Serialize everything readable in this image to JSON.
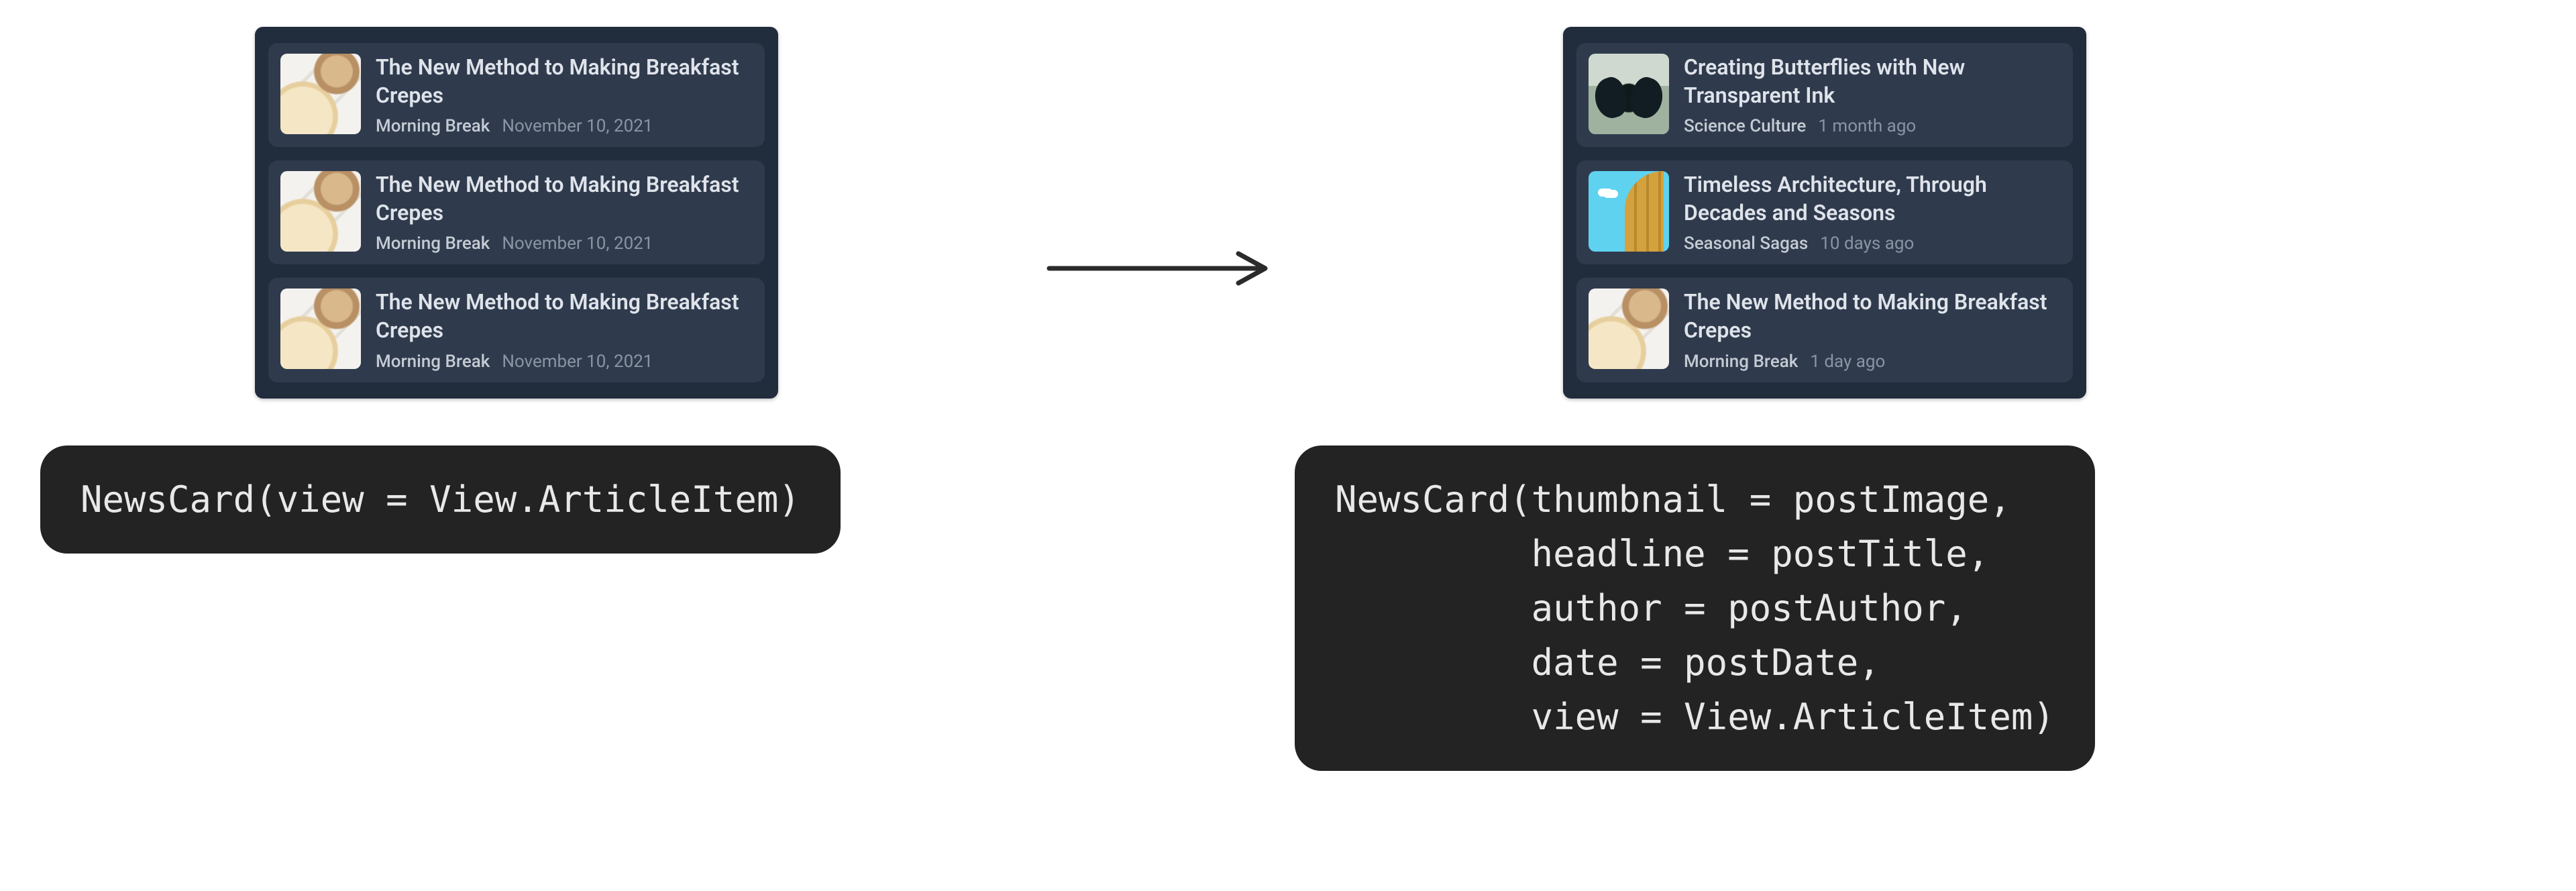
{
  "arrow": {
    "kind": "right"
  },
  "left": {
    "cards": [
      {
        "thumbClass": "thumb-crepes",
        "headline": "The New Method to Making Breakfast Crepes",
        "author": "Morning Break",
        "date": "November 10, 2021"
      },
      {
        "thumbClass": "thumb-crepes",
        "headline": "The New Method to Making Breakfast Crepes",
        "author": "Morning Break",
        "date": "November 10, 2021"
      },
      {
        "thumbClass": "thumb-crepes",
        "headline": "The New Method to Making Breakfast Crepes",
        "author": "Morning Break",
        "date": "November 10, 2021"
      }
    ],
    "code": "NewsCard(view = View.ArticleItem)"
  },
  "right": {
    "cards": [
      {
        "thumbClass": "thumb-butterfly",
        "headline": "Creating Butterflies with New Transparent Ink",
        "author": "Science Culture",
        "date": "1 month ago"
      },
      {
        "thumbClass": "thumb-arch",
        "headline": "Timeless Architecture, Through Decades and Seasons",
        "author": "Seasonal Sagas",
        "date": "10 days ago"
      },
      {
        "thumbClass": "thumb-crepes",
        "headline": "The New Method to Making Breakfast Crepes",
        "author": "Morning Break",
        "date": "1 day ago"
      }
    ],
    "code": "NewsCard(thumbnail = postImage,\n         headline = postTitle,\n         author = postAuthor,\n         date = postDate,\n         view = View.ArticleItem)"
  }
}
